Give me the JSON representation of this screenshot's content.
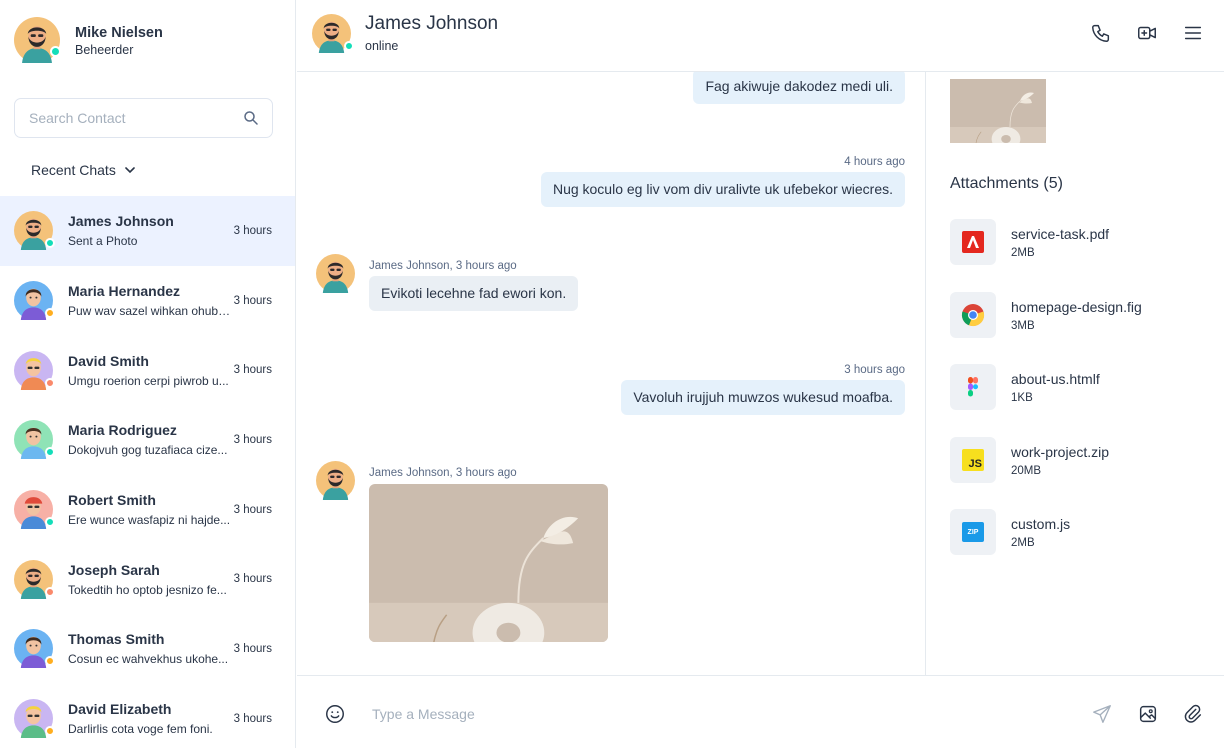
{
  "current_user": {
    "name": "Mike Nielsen",
    "role": "Beheerder",
    "status_color": "#13deb9"
  },
  "search": {
    "placeholder": "Search Contact"
  },
  "recent_chats_label": "Recent Chats",
  "contacts": [
    {
      "name": "James Johnson",
      "message": "Sent a Photo",
      "time": "3 hours",
      "status_color": "#13deb9",
      "active": true
    },
    {
      "name": "Maria Hernandez",
      "message": "Puw wav sazel wihkan ohubu...",
      "time": "3 hours",
      "status_color": "#ffae1f"
    },
    {
      "name": "David Smith",
      "message": "Umgu roerion cerpi piwrob u...",
      "time": "3 hours",
      "status_color": "#fa896b"
    },
    {
      "name": "Maria Rodriguez",
      "message": "Dokojvuh gog tuzafiaca cize...",
      "time": "3 hours",
      "status_color": "#13deb9"
    },
    {
      "name": "Robert Smith",
      "message": "Ere wunce wasfapiz ni hajde...",
      "time": "3 hours",
      "status_color": "#13deb9"
    },
    {
      "name": "Joseph Sarah",
      "message": "Tokedtih ho optob jesnizo fe...",
      "time": "3 hours",
      "status_color": "#fa896b"
    },
    {
      "name": "Thomas Smith",
      "message": "Cosun ec wahvekhus ukohe...",
      "time": "3 hours",
      "status_color": "#ffae1f"
    },
    {
      "name": "David Elizabeth",
      "message": "Darlirlis cota voge fem foni.",
      "time": "3 hours",
      "status_color": "#ffae1f"
    }
  ],
  "chat": {
    "name": "James Johnson",
    "status": "online",
    "messages": {
      "m1": "Fag akiwuje dakodez medi uli.",
      "m2_time": "4 hours ago",
      "m2": "Nug koculo eg liv vom div uralivte uk ufebekor wiecres.",
      "m3_meta": "James Johnson, 3 hours ago",
      "m3": "Evikoti lecehne fad ewori kon.",
      "m4_time": "3 hours ago",
      "m4": "Vavoluh irujjuh muwzos wukesud moafba.",
      "m5_meta": "James Johnson, 3 hours ago"
    }
  },
  "attachments": {
    "title": "Attachments (5)",
    "files": [
      {
        "name": "service-task.pdf",
        "size": "2MB",
        "icon": "pdf-icon"
      },
      {
        "name": "homepage-design.fig",
        "size": "3MB",
        "icon": "chrome-icon"
      },
      {
        "name": "about-us.htmlf",
        "size": "1KB",
        "icon": "figma-icon"
      },
      {
        "name": "work-project.zip",
        "size": "20MB",
        "icon": "js-icon"
      },
      {
        "name": "custom.js",
        "size": "2MB",
        "icon": "zip-icon"
      }
    ],
    "js_badge": "JS",
    "zip_badge": "ZIP"
  },
  "composer": {
    "placeholder": "Type a Message"
  },
  "colors": {
    "primary": "#5d87ff",
    "active_bg": "#ecf2ff",
    "bubble_out": "#e5f1fb",
    "bubble_in": "#eaeff4"
  }
}
